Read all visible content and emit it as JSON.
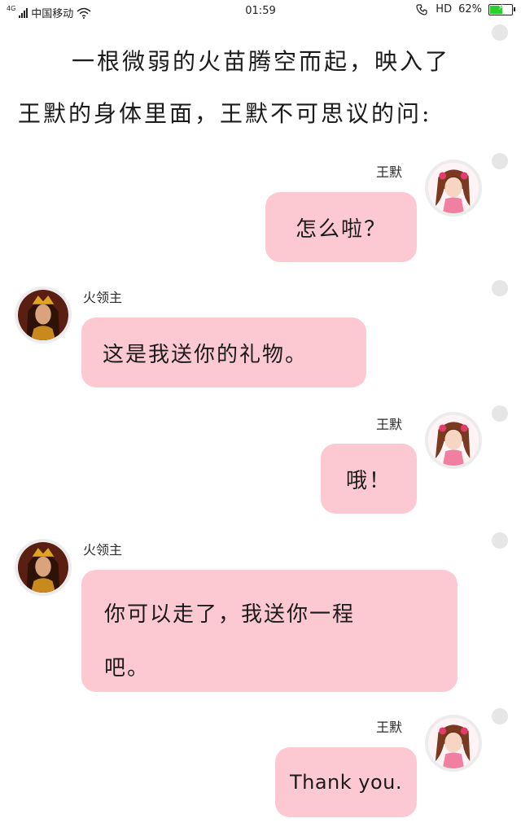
{
  "status_bar": {
    "network": "4G",
    "carrier": "中国移动",
    "time": "01:59",
    "hd": "HD",
    "battery": "62%",
    "battery_level": 0.62
  },
  "story": {
    "line1": "一根微弱的火苗腾空而起，映入了",
    "line2": "王默的身体里面，王默不可思议的问:"
  },
  "messages": [
    {
      "sender": "王默",
      "text": "怎么啦？"
    },
    {
      "sender": "火领主",
      "text": "这是我送你的礼物。"
    },
    {
      "sender": "王默",
      "text": "哦！"
    },
    {
      "sender": "火领主",
      "text_line1": "你可以走了，我送你一程",
      "text_line2": "吧。"
    },
    {
      "sender": "王默",
      "text": "Thank you."
    }
  ],
  "colors": {
    "bubble": "#fcc9d3",
    "dot": "#e6e6e6",
    "battery": "#2bd12b"
  }
}
